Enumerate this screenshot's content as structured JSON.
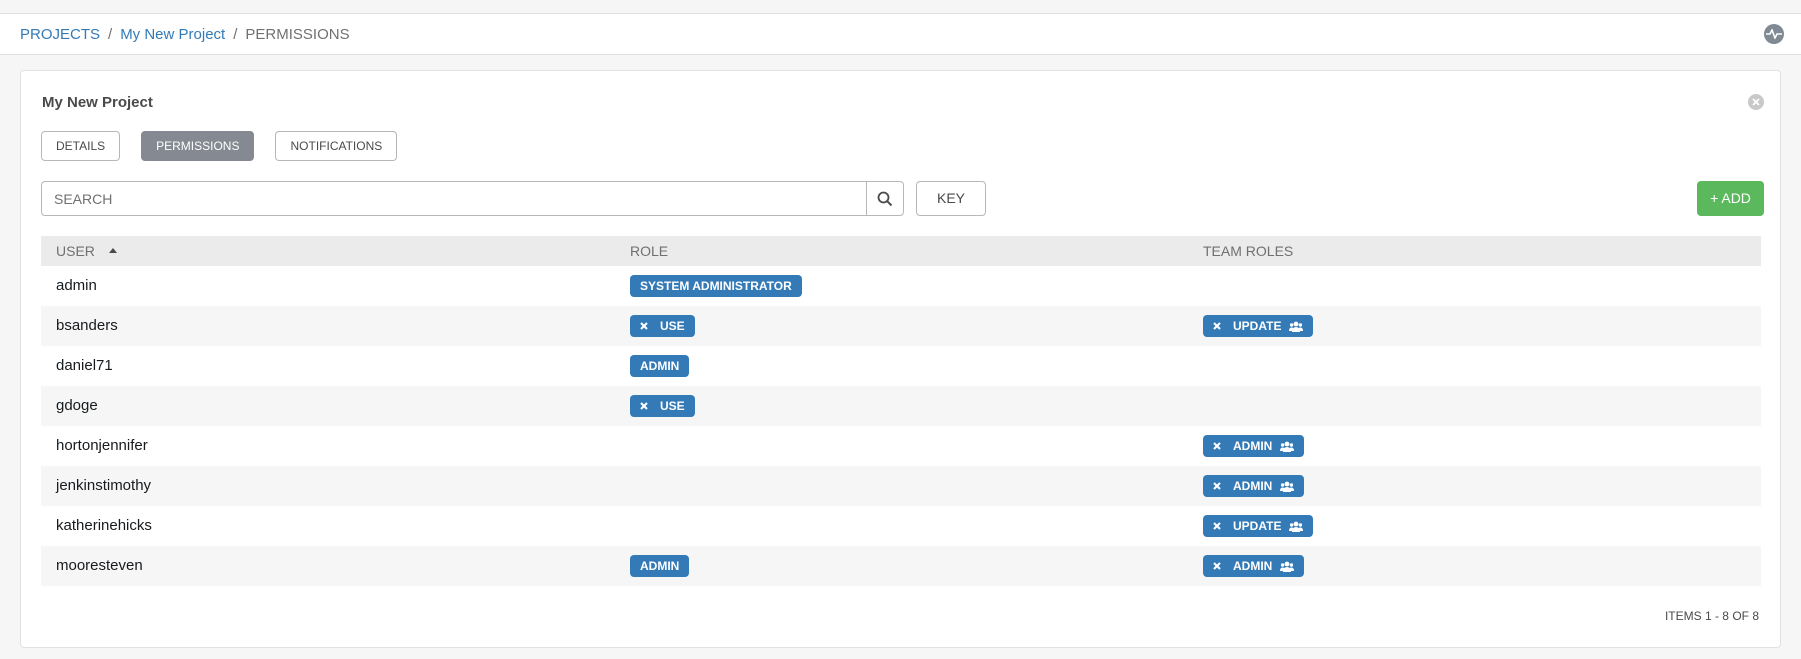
{
  "breadcrumb": {
    "projects": "PROJECTS",
    "project": "My New Project",
    "current": "PERMISSIONS",
    "separator": "/"
  },
  "panel": {
    "title": "My New Project"
  },
  "tabs": [
    {
      "label": "DETAILS",
      "active": false
    },
    {
      "label": "PERMISSIONS",
      "active": true
    },
    {
      "label": "NOTIFICATIONS",
      "active": false
    }
  ],
  "search": {
    "placeholder": "SEARCH",
    "value": ""
  },
  "key_label": "KEY",
  "add_label": "+ ADD",
  "table": {
    "headers": {
      "user": "USER",
      "role": "ROLE",
      "team_roles": "TEAM ROLES"
    },
    "rows": [
      {
        "user": "admin",
        "role": "SYSTEM ADMINISTRATOR",
        "role_removable": false,
        "team_role": ""
      },
      {
        "user": "bsanders",
        "role": "USE",
        "role_removable": true,
        "team_role": "UPDATE"
      },
      {
        "user": "daniel71",
        "role": "ADMIN",
        "role_removable": false,
        "team_role": ""
      },
      {
        "user": "gdoge",
        "role": "USE",
        "role_removable": true,
        "team_role": ""
      },
      {
        "user": "hortonjennifer",
        "role": "",
        "role_removable": false,
        "team_role": "ADMIN"
      },
      {
        "user": "jenkinstimothy",
        "role": "",
        "role_removable": false,
        "team_role": "ADMIN"
      },
      {
        "user": "katherinehicks",
        "role": "",
        "role_removable": false,
        "team_role": "UPDATE"
      },
      {
        "user": "mooresteven",
        "role": "ADMIN",
        "role_removable": false,
        "team_role": "ADMIN"
      }
    ]
  },
  "items_count": "ITEMS  1 - 8 OF 8",
  "colors": {
    "link": "#337ab7",
    "chip": "#337ab7",
    "add_button": "#5cb85c",
    "active_tab": "#848992"
  },
  "icons": {
    "activity": "activity-stream-icon",
    "close": "close-icon",
    "search": "search-icon",
    "sort": "sort-ascending-icon",
    "remove": "remove-x-icon",
    "team": "users-icon"
  }
}
